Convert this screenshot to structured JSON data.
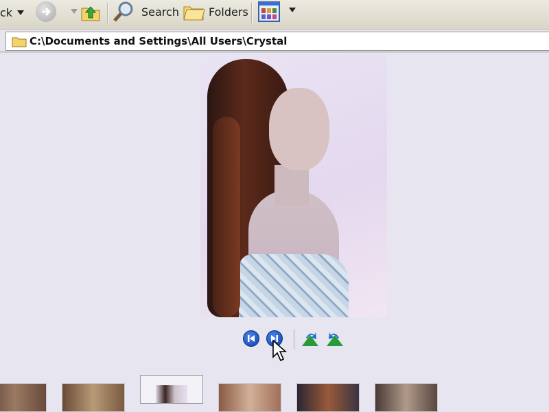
{
  "toolbar": {
    "back_label": "ck",
    "search_label": "Search",
    "folders_label": "Folders",
    "icons": [
      "back-dropdown-arrow",
      "forward-icon",
      "up-folder-icon",
      "search-icon",
      "folders-icon",
      "views-icon"
    ]
  },
  "address": {
    "path": "C:\\Documents and Settings\\All Users\\Crystal",
    "icon": "folder-icon"
  },
  "viewer": {
    "controls": [
      "previous-image-icon",
      "next-image-icon",
      "rotate-clockwise-icon",
      "rotate-counterclockwise-icon"
    ]
  },
  "filmstrip": {
    "thumbnails": [
      {
        "name": "thumb-1",
        "color": "#7c5a48"
      },
      {
        "name": "thumb-2",
        "color": "#8a6a50"
      },
      {
        "name": "thumb-3",
        "color": "#cdc8d8",
        "selected": true
      },
      {
        "name": "thumb-4",
        "color": "#9a6e5c"
      },
      {
        "name": "thumb-5",
        "color": "#3b3442"
      },
      {
        "name": "thumb-6",
        "color": "#6a4e46"
      }
    ]
  },
  "colors": {
    "toolbar_bg": "#dcd9cb",
    "window_bg": "#e7e5f0",
    "nav_blue": "#1e56c8",
    "rotate_green": "#2a9a38"
  }
}
